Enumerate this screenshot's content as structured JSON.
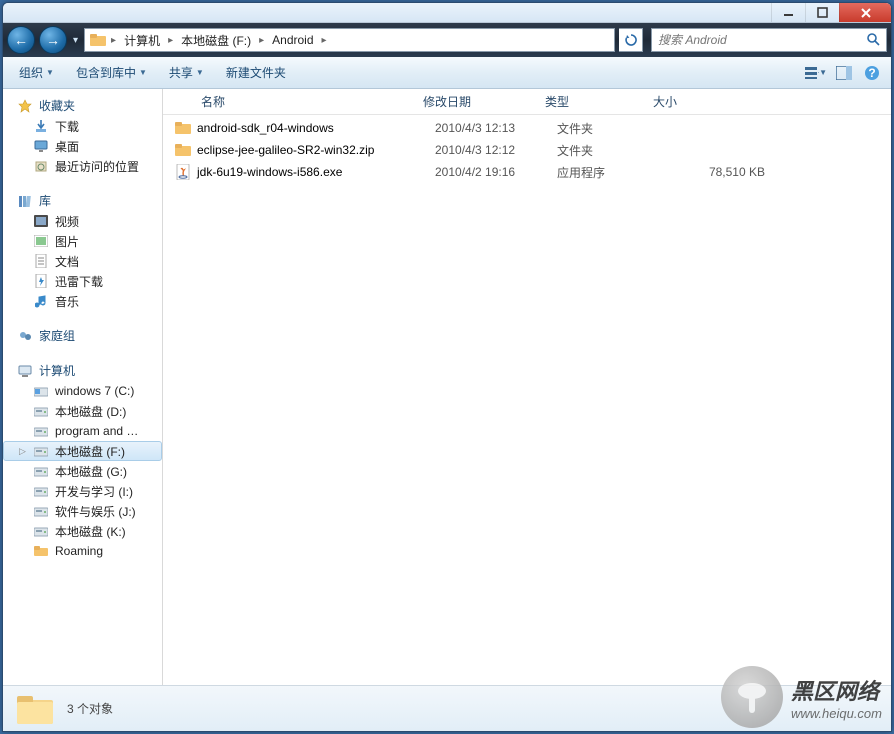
{
  "breadcrumb": {
    "segments": [
      "计算机",
      "本地磁盘 (F:)",
      "Android"
    ]
  },
  "search": {
    "placeholder": "搜索 Android"
  },
  "toolbar": {
    "organize": "组织",
    "include": "包含到库中",
    "share": "共享",
    "newfolder": "新建文件夹"
  },
  "sidebar": {
    "favorites": {
      "label": "收藏夹",
      "items": [
        "下载",
        "桌面",
        "最近访问的位置"
      ]
    },
    "libraries": {
      "label": "库",
      "items": [
        "视频",
        "图片",
        "文档",
        "迅雷下载",
        "音乐"
      ]
    },
    "homegroup": {
      "label": "家庭组"
    },
    "computer": {
      "label": "计算机",
      "items": [
        "windows 7 (C:)",
        "本地磁盘 (D:)",
        "program and …",
        "本地磁盘 (F:)",
        "本地磁盘 (G:)",
        "开发与学习 (I:)",
        "软件与娱乐 (J:)",
        "本地磁盘 (K:)",
        "Roaming"
      ],
      "selected": 3
    }
  },
  "columns": {
    "name": "名称",
    "date": "修改日期",
    "type": "类型",
    "size": "大小"
  },
  "files": [
    {
      "icon": "folder",
      "name": "android-sdk_r04-windows",
      "date": "2010/4/3 12:13",
      "type": "文件夹",
      "size": ""
    },
    {
      "icon": "folder",
      "name": "eclipse-jee-galileo-SR2-win32.zip",
      "date": "2010/4/3 12:12",
      "type": "文件夹",
      "size": ""
    },
    {
      "icon": "java",
      "name": "jdk-6u19-windows-i586.exe",
      "date": "2010/4/2 19:16",
      "type": "应用程序",
      "size": "78,510 KB"
    }
  ],
  "status": {
    "text": "3 个对象"
  },
  "watermark": {
    "title": "黑区网络",
    "sub": "www.heiqu.com"
  }
}
